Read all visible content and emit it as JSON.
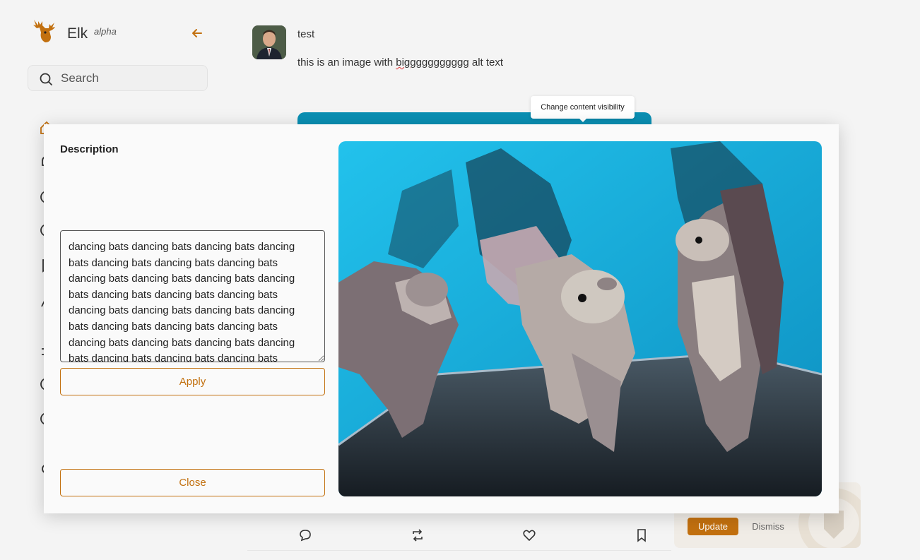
{
  "sidebar": {
    "brand": "Elk",
    "badge": "alpha",
    "search_placeholder": "Search"
  },
  "post": {
    "title": "test",
    "text_before": "this is an image with ",
    "text_misspelled": "biggggggggggg",
    "text_after": " alt text",
    "tooltip": "Change content visibility"
  },
  "update_banner": {
    "update_label": "Update",
    "dismiss_label": "Dismiss"
  },
  "modal": {
    "description_label": "Description",
    "description_value": "dancing bats dancing bats dancing bats dancing bats dancing bats dancing bats dancing bats dancing bats dancing bats dancing bats dancing bats dancing bats dancing bats dancing bats dancing bats dancing bats dancing bats dancing bats dancing bats dancing bats dancing bats dancing bats dancing bats dancing bats dancing bats dancing bats dancing bats dancing bats dancing bats dancing bats dancing bats dancing bats",
    "apply_label": "Apply",
    "close_label": "Close"
  },
  "colors": {
    "accent": "#c2700f",
    "image_background": "#1bb3e0"
  }
}
